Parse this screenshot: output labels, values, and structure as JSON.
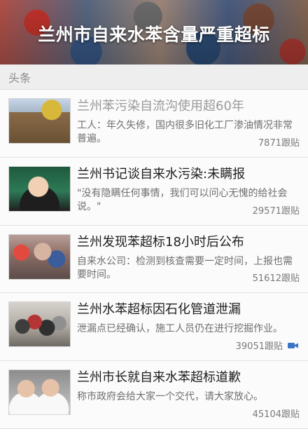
{
  "banner": {
    "title": "兰州市自来水苯含量严重超标"
  },
  "section": {
    "label": "头条"
  },
  "feed": {
    "items": [
      {
        "title": "兰州苯污染自流沟使用超60年",
        "summary": "工人：年久失修，国内很多旧化工厂渗油情况非常普遍。",
        "meta": "7871跟贴"
      },
      {
        "title": "兰州书记谈自来水污染:未瞒报",
        "summary": "\"没有隐瞒任何事情，我们可以问心无愧的给社会说。\"",
        "meta": "29571跟贴"
      },
      {
        "title": "兰州发现苯超标18小时后公布",
        "summary": "自来水公司：检测到核查需要一定时间，上报也需要时间。",
        "meta": "51612跟贴"
      },
      {
        "title": "兰州水苯超标因石化管道泄漏",
        "summary": "泄漏点已经确认，施工人员仍在进行挖掘作业。",
        "meta": "39051跟贴"
      },
      {
        "title": "兰州市长就自来水苯超标道歉",
        "summary": "称市政府会给大家一个交代，请大家放心。",
        "meta": "45104跟贴"
      }
    ]
  },
  "colors": {
    "video_icon": "#3b74c6"
  },
  "icons": {
    "video": "video-icon"
  }
}
